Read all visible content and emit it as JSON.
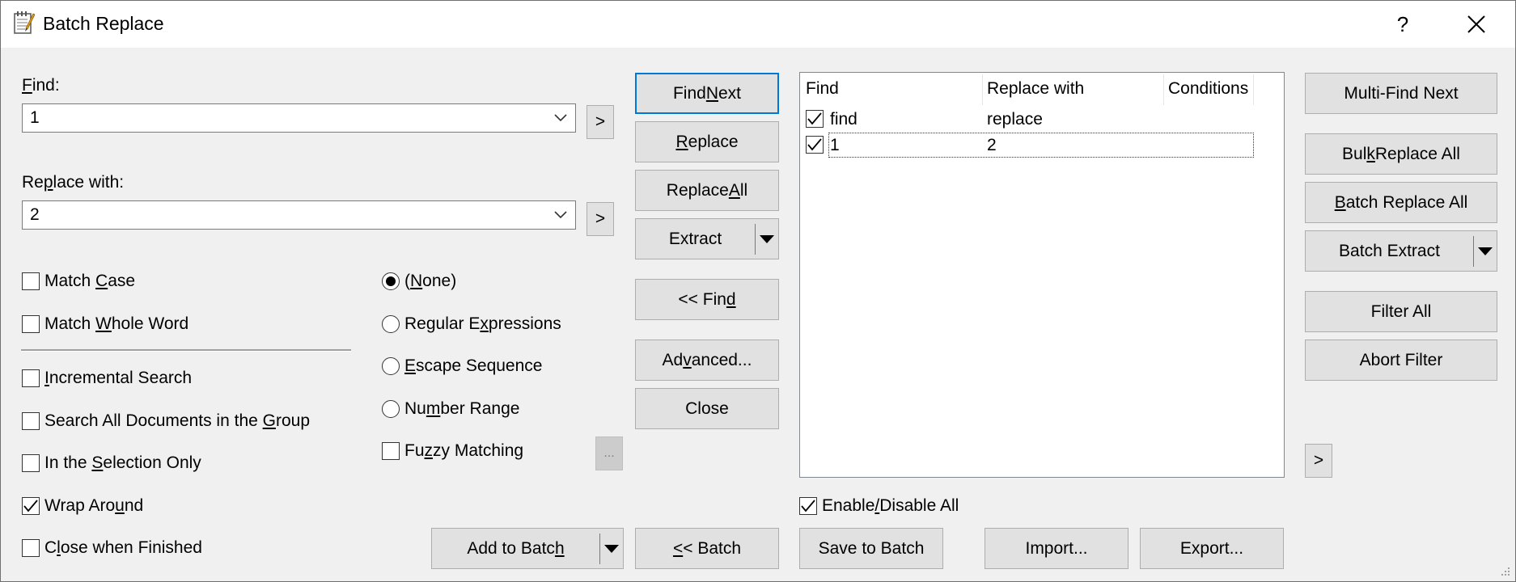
{
  "window": {
    "title": "Batch Replace",
    "help_label": "?",
    "close_label": "✕",
    "icons": {
      "app": "notepad-icon",
      "close": "close-icon"
    }
  },
  "find": {
    "label_pre": "",
    "label_u": "F",
    "label_post": "ind:",
    "value": "1",
    "expand_label": ">"
  },
  "replace": {
    "label_pre": "Re",
    "label_u": "p",
    "label_post": "lace with:",
    "value": "2",
    "expand_label": ">"
  },
  "options": {
    "match_case": {
      "pre": "Match ",
      "u": "C",
      "post": "ase",
      "checked": false
    },
    "match_whole_word": {
      "pre": "Match ",
      "u": "W",
      "post": "hole Word",
      "checked": false
    },
    "incremental_search": {
      "pre": "",
      "u": "I",
      "post": "ncremental Search",
      "checked": false
    },
    "search_all_docs": {
      "pre": "Search All Documents in the ",
      "u": "G",
      "post": "roup",
      "checked": false
    },
    "selection_only": {
      "pre": "In the ",
      "u": "S",
      "post": "election Only",
      "checked": false
    },
    "wrap_around": {
      "pre": "Wrap Aro",
      "u": "u",
      "post": "nd",
      "checked": true
    },
    "close_when_finished": {
      "pre": "C",
      "u": "l",
      "post": "ose when Finished",
      "checked": false
    }
  },
  "mode": {
    "none": {
      "pre": "(",
      "u": "N",
      "post": "one)",
      "selected": true
    },
    "regex": {
      "pre": "Regular E",
      "u": "x",
      "post": "pressions",
      "selected": false
    },
    "escape": {
      "pre": "",
      "u": "E",
      "post": "scape Sequence",
      "selected": false
    },
    "number_range": {
      "pre": "Nu",
      "u": "m",
      "post": "ber Range",
      "selected": false
    },
    "fuzzy": {
      "pre": "Fu",
      "u": "z",
      "post": "zy Matching",
      "checked": false
    },
    "fuzzy_options_label": "..."
  },
  "actions": {
    "find_next": {
      "pre": "Find ",
      "u": "N",
      "post": "ext"
    },
    "replace": {
      "pre": "",
      "u": "R",
      "post": "eplace"
    },
    "replace_all": {
      "pre": "Replace ",
      "u": "A",
      "post": "ll"
    },
    "extract": "Extract",
    "find_toggle": {
      "pre": "<< Fin",
      "u": "d",
      "post": ""
    },
    "advanced": {
      "pre": "Ad",
      "u": "v",
      "post": "anced..."
    },
    "close": "Close",
    "add_to_batch": {
      "pre": "Add to Batc",
      "u": "h",
      "post": ""
    },
    "batch_toggle": {
      "pre": "",
      "u": "<",
      "post": "< Batch"
    }
  },
  "batch_list": {
    "columns": [
      "Find",
      "Replace with",
      "Conditions"
    ],
    "rows": [
      {
        "checked": true,
        "find": "find",
        "replace": "replace",
        "conditions": ""
      },
      {
        "checked": true,
        "find": "1",
        "replace": "2",
        "conditions": ""
      }
    ],
    "enable_all": {
      "pre": "Enable",
      "u": "/",
      "post": "Disable All",
      "checked": true
    }
  },
  "batch_buttons": {
    "save_to_batch": "Save to Batch",
    "import": "Import...",
    "export": "Export..."
  },
  "multi": {
    "multi_find_next": "Multi-Find Next",
    "bulk_replace_all": {
      "pre": "Bul",
      "u": "k",
      "post": " Replace All"
    },
    "batch_replace_all": {
      "pre": "",
      "u": "B",
      "post": "atch Replace All"
    },
    "batch_extract": "Batch Extract",
    "filter_all": "Filter All",
    "abort_filter": "Abort Filter",
    "more_label": ">"
  }
}
